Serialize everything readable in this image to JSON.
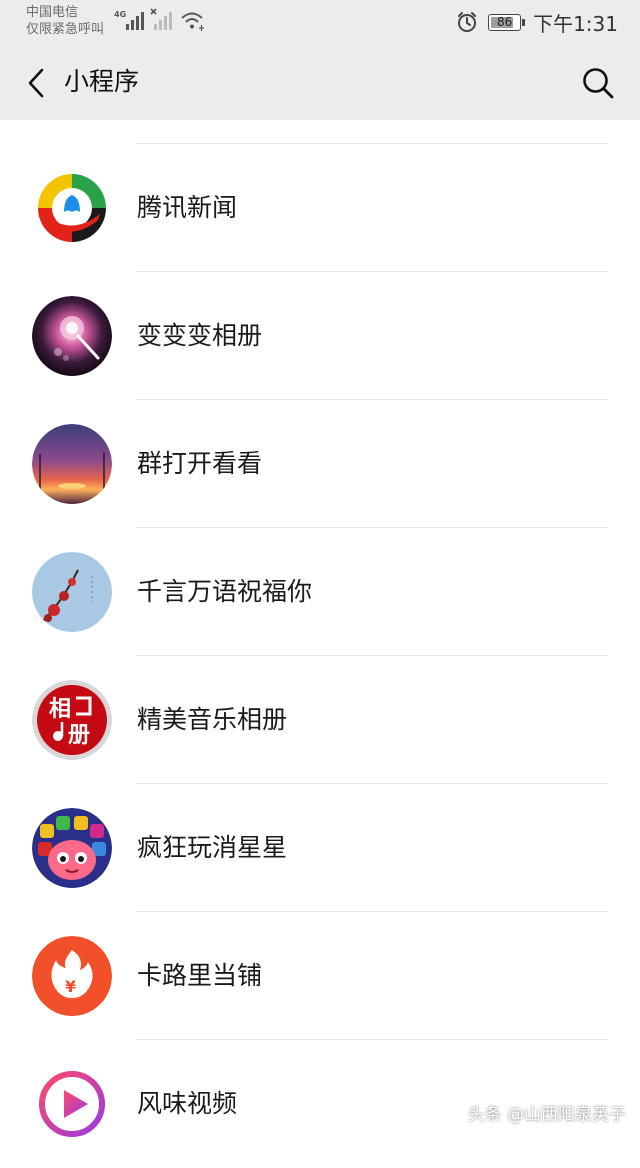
{
  "status_bar": {
    "carrier_line1": "中国电信",
    "carrier_line2": "仅限紧急呼叫",
    "network_type": "4G",
    "battery_level": "86",
    "time": "下午1:31",
    "icons": [
      "signal-icon",
      "signal-no-service-icon",
      "wifi-icon",
      "alarm-icon",
      "battery-icon"
    ]
  },
  "header": {
    "title": "小程序",
    "back_icon": "chevron-left-icon",
    "search_icon": "search-icon"
  },
  "mini_programs": [
    {
      "name": "腾讯新闻",
      "icon": "tencent-news-logo"
    },
    {
      "name": "变变变相册",
      "icon": "magic-wand-icon"
    },
    {
      "name": "群打开看看",
      "icon": "sunset-photo"
    },
    {
      "name": "千言万语祝福你",
      "icon": "flower-branch-photo"
    },
    {
      "name": "精美音乐相册",
      "icon": "music-album-logo",
      "icon_text_top": "相",
      "icon_text_bottom": "册"
    },
    {
      "name": "疯狂玩消星星",
      "icon": "game-blocks-logo"
    },
    {
      "name": "卡路里当铺",
      "icon": "flame-logo",
      "icon_text": "¥"
    },
    {
      "name": "风味视频",
      "icon": "play-button-logo"
    }
  ],
  "watermark": "头条 @山西阳泉英子",
  "colors": {
    "header_bg": "#ececec",
    "divider": "#e6e6e6",
    "text": "#1a1a1a"
  }
}
